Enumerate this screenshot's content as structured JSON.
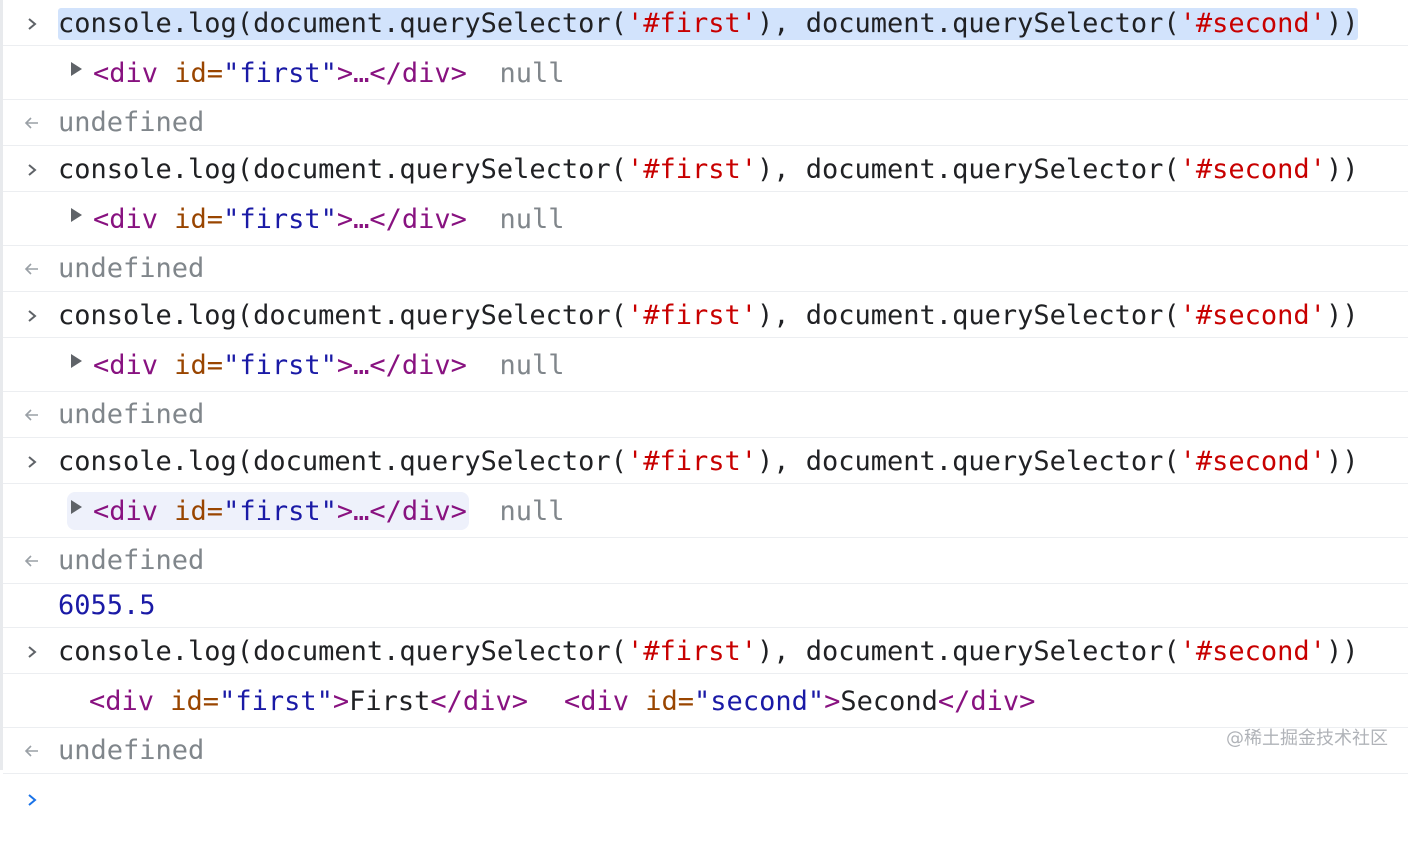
{
  "watermark": "@稀土掘金技术社区",
  "command": {
    "pre1": "console.log(document.querySelector(",
    "str1": "'#first'",
    "mid": "), document.querySelector(",
    "str2": "'#second'",
    "post": "))"
  },
  "log_collapsed": {
    "open": "<div",
    "attr": "id=",
    "value": "\"first\"",
    "close": ">…</div>",
    "null": "null"
  },
  "result_text": "undefined",
  "number_output": "6055.5",
  "log_expanded": {
    "open1": "<div",
    "attr1": "id=",
    "value1": "\"first\"",
    "gt1": ">",
    "content1": "First",
    "end1": "</div>",
    "open2": "<div",
    "attr2": "id=",
    "value2": "\"second\"",
    "gt2": ">",
    "content2": "Second",
    "end2": "</div>"
  },
  "icons": {
    "input_prompt": "chevron-right-icon",
    "result_prompt": "return-arrow-icon",
    "expand": "expand-triangle-icon"
  }
}
